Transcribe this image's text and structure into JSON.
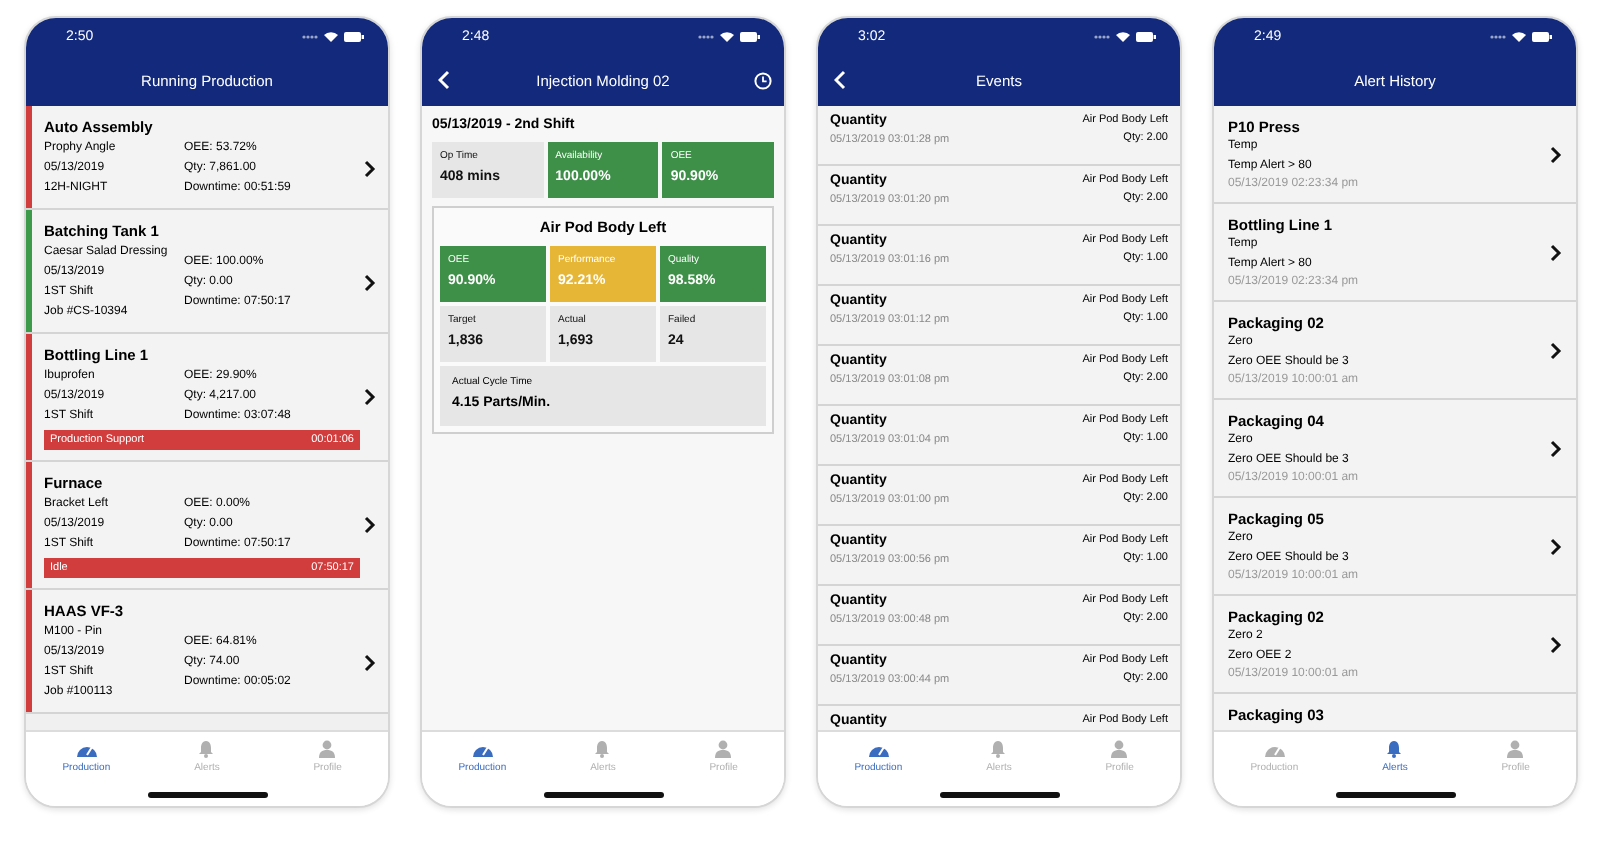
{
  "phones": [
    {
      "kind": "production",
      "status_time": "2:50",
      "title": "Running Production",
      "back": false,
      "history": false,
      "machines": [
        {
          "name": "Auto Assembly",
          "color": "#d13c3c",
          "details": [
            "Prophy Angle",
            "05/13/2019",
            "12H-NIGHT"
          ],
          "stats": [
            "OEE: 53.72%",
            "Qty: 7,861.00",
            "Downtime: 00:51:59"
          ]
        },
        {
          "name": "Batching Tank 1",
          "color": "#3e9a4b",
          "details": [
            "Caesar Salad Dressing",
            "05/13/2019",
            "1ST Shift",
            "Job #CS-10394"
          ],
          "stats": [
            "OEE: 100.00%",
            "Qty: 0.00",
            "Downtime: 07:50:17"
          ]
        },
        {
          "name": "Bottling Line 1",
          "color": "#d13c3c",
          "details": [
            "Ibuprofen",
            "05/13/2019",
            "1ST Shift"
          ],
          "stats": [
            "OEE: 29.90%",
            "Qty: 4,217.00",
            "Downtime: 03:07:48"
          ],
          "banner": {
            "label": "Production Support",
            "time": "00:01:06"
          }
        },
        {
          "name": "Furnace",
          "color": "#d13c3c",
          "details": [
            "Bracket Left",
            "05/13/2019",
            "1ST Shift"
          ],
          "stats": [
            "OEE: 0.00%",
            "Qty: 0.00",
            "Downtime: 07:50:17"
          ],
          "banner": {
            "label": "Idle",
            "time": "07:50:17"
          }
        },
        {
          "name": "HAAS VF-3",
          "color": "#d13c3c",
          "details": [
            "M100 - Pin",
            "05/13/2019",
            "1ST Shift",
            "Job #100113"
          ],
          "stats": [
            "OEE: 64.81%",
            "Qty: 74.00",
            "Downtime: 00:05:02"
          ]
        }
      ],
      "tabs": [
        {
          "label": "Production",
          "selected": true
        },
        {
          "label": "Alerts",
          "selected": false
        },
        {
          "label": "Profile",
          "selected": false
        }
      ]
    },
    {
      "kind": "detail",
      "status_time": "2:48",
      "title": "Injection Molding 02",
      "back": true,
      "history": true,
      "shift": "05/13/2019 - 2nd Shift",
      "summary": [
        {
          "label": "Op Time",
          "value": "408 mins",
          "color": "#e6e6e6"
        },
        {
          "label": "Availability",
          "value": "100.00%",
          "color": "#3e8f48"
        },
        {
          "label": "OEE",
          "value": "90.90%",
          "color": "#3e8f48"
        }
      ],
      "product": {
        "title": "Air Pod Body Left",
        "metrics": [
          {
            "label": "OEE",
            "value": "90.90%",
            "color": "#3e8f48"
          },
          {
            "label": "Performance",
            "value": "92.21%",
            "color": "#e6b637"
          },
          {
            "label": "Quality",
            "value": "98.58%",
            "color": "#3e8f48"
          }
        ],
        "counts": [
          {
            "label": "Target",
            "value": "1,836",
            "color": "#e6e6e6"
          },
          {
            "label": "Actual",
            "value": "1,693",
            "color": "#e6e6e6"
          },
          {
            "label": "Failed",
            "value": "24",
            "color": "#e6e6e6"
          }
        ],
        "cycle": {
          "label": "Actual Cycle Time",
          "value": "4.15 Parts/Min."
        }
      },
      "tabs": [
        {
          "label": "Production",
          "selected": true
        },
        {
          "label": "Alerts",
          "selected": false
        },
        {
          "label": "Profile",
          "selected": false
        }
      ]
    },
    {
      "kind": "events",
      "status_time": "3:02",
      "title": "Events",
      "back": true,
      "history": false,
      "events": [
        {
          "title": "Quantity",
          "time": "05/13/2019 03:01:28 pm",
          "product": "Air Pod Body Left",
          "qty": "Qty: 2.00"
        },
        {
          "title": "Quantity",
          "time": "05/13/2019 03:01:20 pm",
          "product": "Air Pod Body Left",
          "qty": "Qty: 2.00"
        },
        {
          "title": "Quantity",
          "time": "05/13/2019 03:01:16 pm",
          "product": "Air Pod Body Left",
          "qty": "Qty: 1.00"
        },
        {
          "title": "Quantity",
          "time": "05/13/2019 03:01:12 pm",
          "product": "Air Pod Body Left",
          "qty": "Qty: 1.00"
        },
        {
          "title": "Quantity",
          "time": "05/13/2019 03:01:08 pm",
          "product": "Air Pod Body Left",
          "qty": "Qty: 2.00"
        },
        {
          "title": "Quantity",
          "time": "05/13/2019 03:01:04 pm",
          "product": "Air Pod Body Left",
          "qty": "Qty: 1.00"
        },
        {
          "title": "Quantity",
          "time": "05/13/2019 03:01:00 pm",
          "product": "Air Pod Body Left",
          "qty": "Qty: 2.00"
        },
        {
          "title": "Quantity",
          "time": "05/13/2019 03:00:56 pm",
          "product": "Air Pod Body Left",
          "qty": "Qty: 1.00"
        },
        {
          "title": "Quantity",
          "time": "05/13/2019 03:00:48 pm",
          "product": "Air Pod Body Left",
          "qty": "Qty: 2.00"
        },
        {
          "title": "Quantity",
          "time": "05/13/2019 03:00:44 pm",
          "product": "Air Pod Body Left",
          "qty": "Qty: 2.00"
        },
        {
          "title": "Quantity",
          "product": "Air Pod Body Left"
        }
      ],
      "tabs": [
        {
          "label": "Production",
          "selected": true
        },
        {
          "label": "Alerts",
          "selected": false
        },
        {
          "label": "Profile",
          "selected": false
        }
      ]
    },
    {
      "kind": "alerts",
      "status_time": "2:49",
      "title": "Alert History",
      "back": false,
      "history": false,
      "alerts": [
        {
          "machine": "P10 Press",
          "type": "Temp",
          "message": "Temp Alert > 80",
          "time": "05/13/2019 02:23:34 pm"
        },
        {
          "machine": "Bottling Line 1",
          "type": "Temp",
          "message": "Temp Alert > 80",
          "time": "05/13/2019 02:23:34 pm"
        },
        {
          "machine": "Packaging 02",
          "type": "Zero",
          "message": "Zero OEE Should be 3",
          "time": "05/13/2019 10:00:01 am"
        },
        {
          "machine": "Packaging 04",
          "type": "Zero",
          "message": "Zero OEE Should be 3",
          "time": "05/13/2019 10:00:01 am"
        },
        {
          "machine": "Packaging 05",
          "type": "Zero",
          "message": "Zero OEE Should be 3",
          "time": "05/13/2019 10:00:01 am"
        },
        {
          "machine": "Packaging 02",
          "type": "Zero 2",
          "message": "Zero OEE 2",
          "time": "05/13/2019 10:00:01 am"
        },
        {
          "machine": "Packaging 03"
        }
      ],
      "tabs": [
        {
          "label": "Production",
          "selected": false
        },
        {
          "label": "Alerts",
          "selected": true
        },
        {
          "label": "Profile",
          "selected": false
        }
      ]
    }
  ]
}
